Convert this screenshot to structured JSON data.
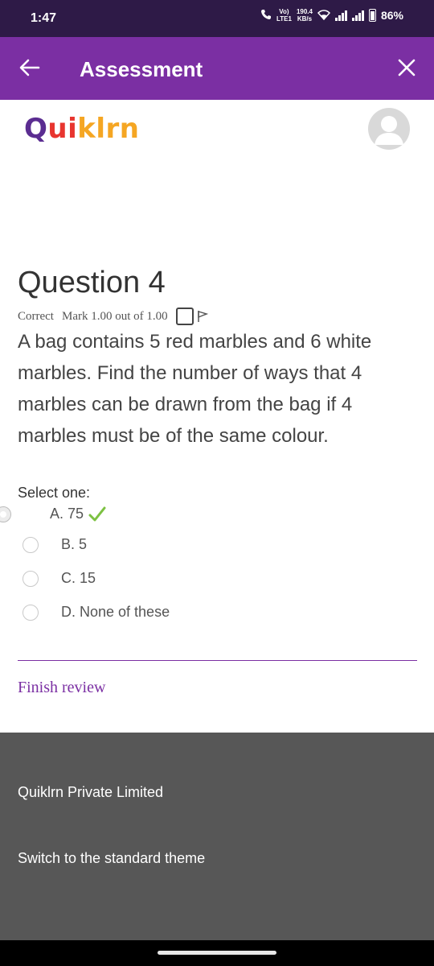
{
  "status_bar": {
    "time": "1:47",
    "network_top": "190.4",
    "network_bottom": "KB/s",
    "volte_top": "Vo)",
    "volte_bottom": "LTE1",
    "battery": "86%"
  },
  "app_bar": {
    "title": "Assessment",
    "back_icon": "arrow-left-icon",
    "close_icon": "close-icon"
  },
  "brand": {
    "logo_part1": "Q",
    "logo_part2": "ui",
    "logo_part3": "klrn",
    "colors": {
      "purple": "#5b2d91",
      "red": "#e8352f",
      "orange": "#f5a623"
    }
  },
  "question": {
    "title": "Question 4",
    "status": "Correct",
    "mark": "Mark 1.00 out of 1.00",
    "text": "A bag contains 5 red marbles and 6 white marbles. Find the number of ways that 4 marbles can be drawn from the bag if 4 marbles must be of the same colour.",
    "prompt": "Select one:",
    "options": [
      {
        "label": "A. 75",
        "selected": true,
        "correct": true
      },
      {
        "label": "B. 5",
        "selected": false
      },
      {
        "label": "C. 15",
        "selected": false
      },
      {
        "label": "D. None of these",
        "selected": false
      }
    ]
  },
  "actions": {
    "finish_review": "Finish review"
  },
  "footer": {
    "company": "Quiklrn Private Limited",
    "switch_theme": "Switch to the standard theme"
  },
  "theme": {
    "accent": "#7b2fa3",
    "status_bar_bg": "#2e1a47",
    "footer_bg": "#575757",
    "correct_check": "#7cc142"
  }
}
